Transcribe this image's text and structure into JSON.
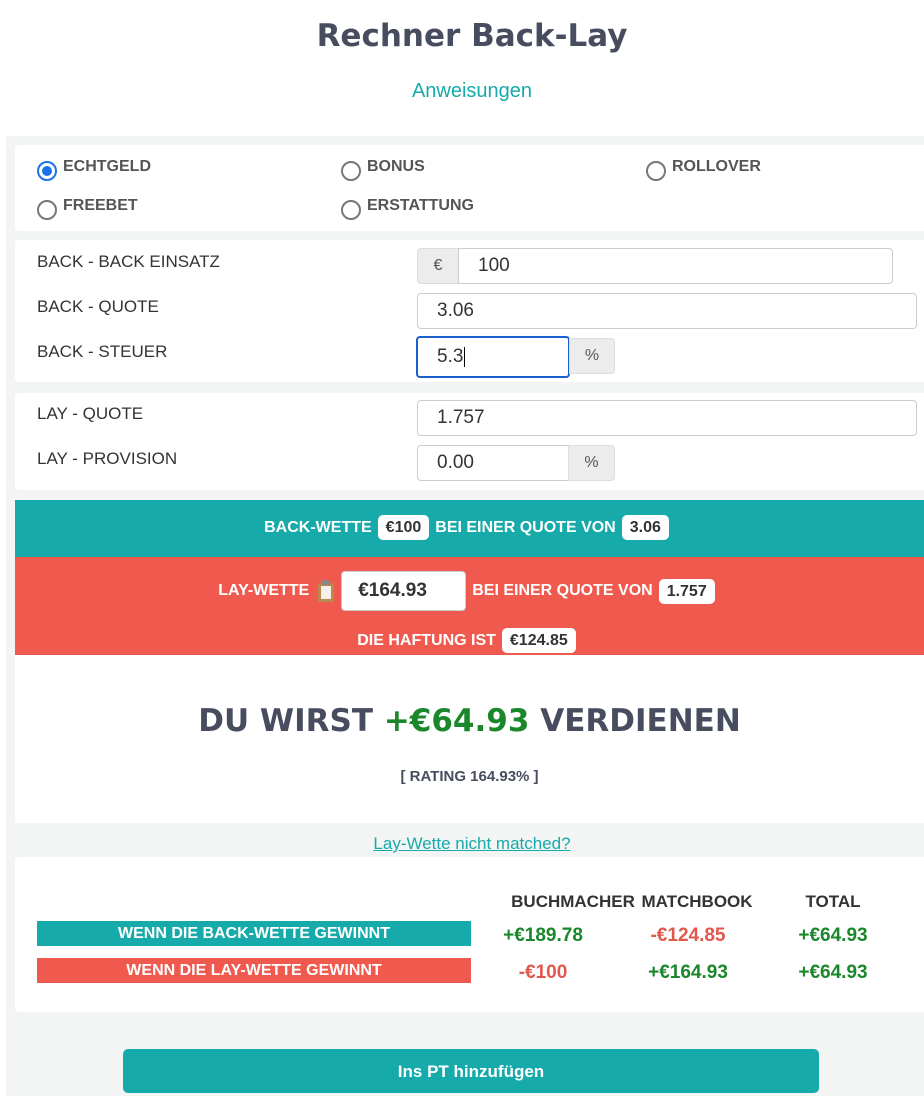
{
  "header": {
    "title": "Rechner Back-Lay",
    "instructions_link": "Anweisungen"
  },
  "bet_types": [
    {
      "label": "ECHTGELD",
      "checked": true
    },
    {
      "label": "BONUS",
      "checked": false
    },
    {
      "label": "ROLLOVER",
      "checked": false
    },
    {
      "label": "FREEBET",
      "checked": false
    },
    {
      "label": "ERSTATTUNG",
      "checked": false
    }
  ],
  "back": {
    "stake_label": "BACK - BACK EINSATZ",
    "currency_symbol": "€",
    "stake_value": "100",
    "odds_label": "BACK - QUOTE",
    "odds_value": "3.06",
    "tax_label": "BACK - STEUER",
    "tax_value": "5.3",
    "tax_unit": "%"
  },
  "lay": {
    "odds_label": "LAY - QUOTE",
    "odds_value": "1.757",
    "commission_label": "LAY - PROVISION",
    "commission_value": "0.00",
    "commission_unit": "%"
  },
  "summary": {
    "back_bet_label": "BACK-WETTE",
    "back_bet_amount": "€100",
    "at_odds_label": "BEI EINER QUOTE VON",
    "back_odds": "3.06",
    "lay_bet_label": "LAY-WETTE",
    "lay_bet_amount": "€164.93",
    "lay_odds": "1.757",
    "liability_label": "DIE HAFTUNG IST",
    "liability_amount": "€124.85"
  },
  "result": {
    "prefix": "DU WIRST",
    "profit": "+€64.93",
    "suffix": "VERDIENEN",
    "rating": "[ RATING 164.93% ]"
  },
  "not_matched_link": "Lay-Wette nicht matched?",
  "breakdown": {
    "columns": [
      "BUCHMACHER",
      "MATCHBOOK",
      "TOTAL"
    ],
    "rows": [
      {
        "label": "WENN DIE BACK-WETTE GEWINNT",
        "values": [
          "+€189.78",
          "-€124.85",
          "+€64.93"
        ]
      },
      {
        "label": "WENN DIE LAY-WETTE GEWINNT",
        "values": [
          "-€100",
          "+€164.93",
          "+€64.93"
        ]
      }
    ]
  },
  "add_button": "Ins PT hinzufügen",
  "colors": {
    "teal": "#17aaaa",
    "coral": "#f05a4e",
    "green": "#19872a",
    "red": "#e2574c",
    "title": "#474d5f"
  }
}
